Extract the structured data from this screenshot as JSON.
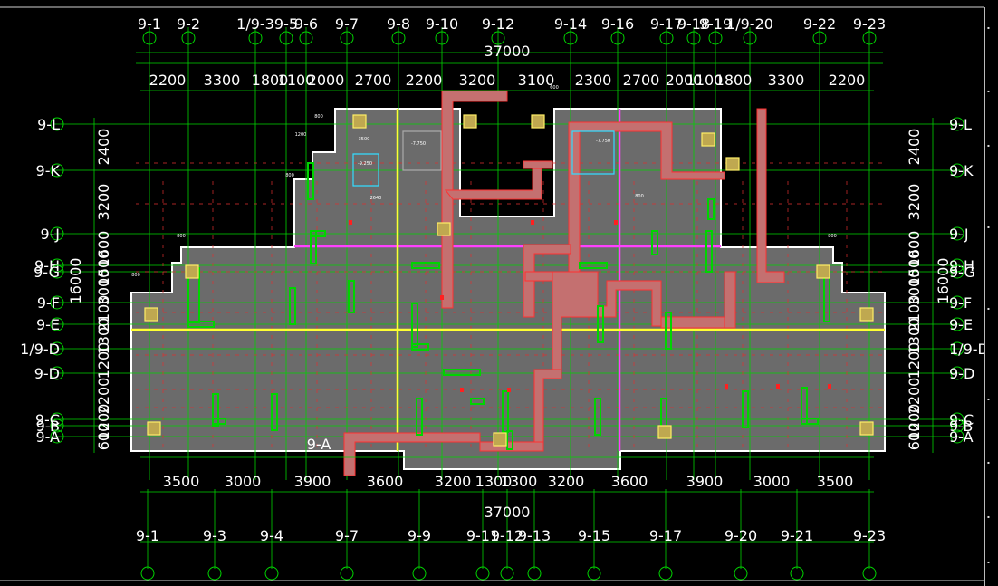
{
  "plan": {
    "top_axes": [
      "9-1",
      "9-2",
      "1/9-3",
      "9-5",
      "9-6",
      "9-7",
      "9-8",
      "9-10",
      "9-12",
      "9-14",
      "9-16",
      "9-17",
      "9-18",
      "9-19",
      "1/9-20",
      "9-22",
      "9-23"
    ],
    "top_total": "37000",
    "top_dims": [
      "2200",
      "3300",
      "1800",
      "1100",
      "2000",
      "2700",
      "2200",
      "3200",
      "3100",
      "2300",
      "2700",
      "2000",
      "1100",
      "1800",
      "3300",
      "2200"
    ],
    "bottom_dims": [
      "3500",
      "3000",
      "3900",
      "3600",
      "3200",
      "1300",
      "1300",
      "3200",
      "3600",
      "3900",
      "3000",
      "3500"
    ],
    "bottom_total": "37000",
    "bottom_axes": [
      "9-1",
      "9-3",
      "9-4",
      "9-7",
      "9-9",
      "9-11",
      "9-12",
      "9-13",
      "9-15",
      "9-17",
      "9-20",
      "9-21",
      "9-23"
    ],
    "left_rows": [
      "9-L",
      "9-K",
      "9-J",
      "9-H",
      "9-G",
      "9-F",
      "9-E",
      "1/9-D",
      "9-D",
      "9-C",
      "9-B",
      "9-A"
    ],
    "right_rows": [
      "9-L",
      "9-K",
      "9-J",
      "9-H",
      "9-G",
      "9-F",
      "9-E",
      "1/9-D",
      "9-D",
      "9-C",
      "9-B",
      "9-A"
    ],
    "left_dims": [
      "2400",
      "3200",
      "1600",
      "1500",
      "3000",
      "2100",
      "1300",
      "1200",
      "2200",
      "1200",
      "600"
    ],
    "left_total": "16000",
    "right_dims": [
      "2400",
      "3200",
      "1600",
      "1500",
      "3000",
      "2100",
      "1300",
      "1200",
      "2200",
      "1200",
      "600"
    ],
    "right_total": "16000",
    "inner_label": "9-A",
    "level_marks": [
      "-7.750",
      "-7.750",
      "-9.250"
    ],
    "small_dims": [
      "800",
      "800",
      "1200",
      "3500",
      "2640",
      "800",
      "600",
      "800",
      "800",
      "800"
    ]
  }
}
